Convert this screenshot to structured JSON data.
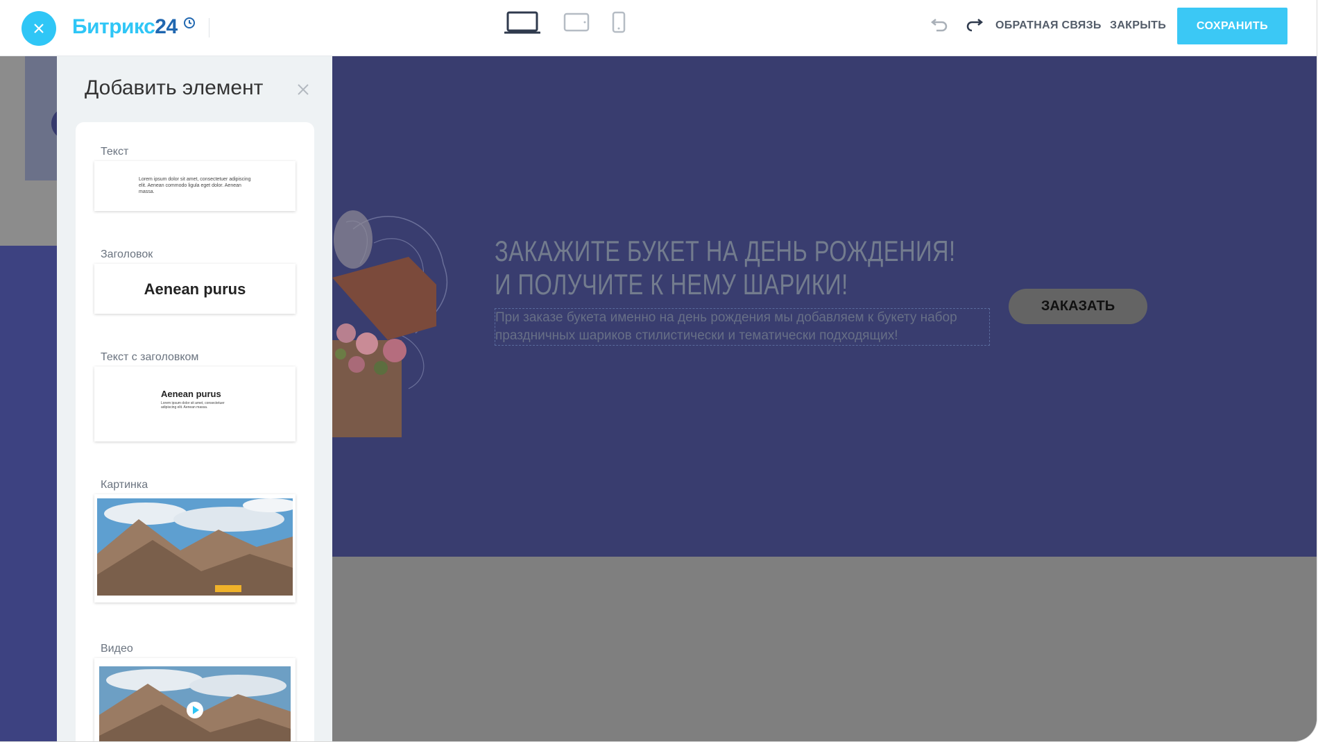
{
  "app": {
    "logo_text": "Битрикс",
    "logo_num": "24"
  },
  "toolbar": {
    "feedback_label": "ОБРАТНАЯ СВЯЗЬ",
    "close_label": "ЗАКРЫТЬ",
    "save_label": "СОХРАНИТЬ"
  },
  "panel": {
    "title": "Добавить элемент",
    "items": [
      {
        "label": "Текст",
        "preview_text": "Lorem ipsum dolor sit amet, consectetuer adipiscing elit. Aenean commodo ligula eget dolor. Aenean massa."
      },
      {
        "label": "Заголовок",
        "preview_heading": "Aenean purus"
      },
      {
        "label": "Текст с заголовком",
        "preview_heading": "Aenean purus",
        "preview_text": "Lorem ipsum dolor sit amet, consectetuer adipiscing elit. Aenean massa."
      },
      {
        "label": "Картинка"
      },
      {
        "label": "Видео"
      }
    ]
  },
  "hero": {
    "title_line1": "Закажите букет на день рождения!",
    "title_line2": "И получите к нему шарики!",
    "text": "При заказе букета именно на день рождения мы добавляем к букету набор праздничных шариков стилистически и тематически подходящих!",
    "button_label": "ЗАКАЗАТЬ"
  },
  "colors": {
    "accent": "#2fc6f6",
    "save_button": "#3bc8f5",
    "canvas_blue": "#393d6f"
  }
}
